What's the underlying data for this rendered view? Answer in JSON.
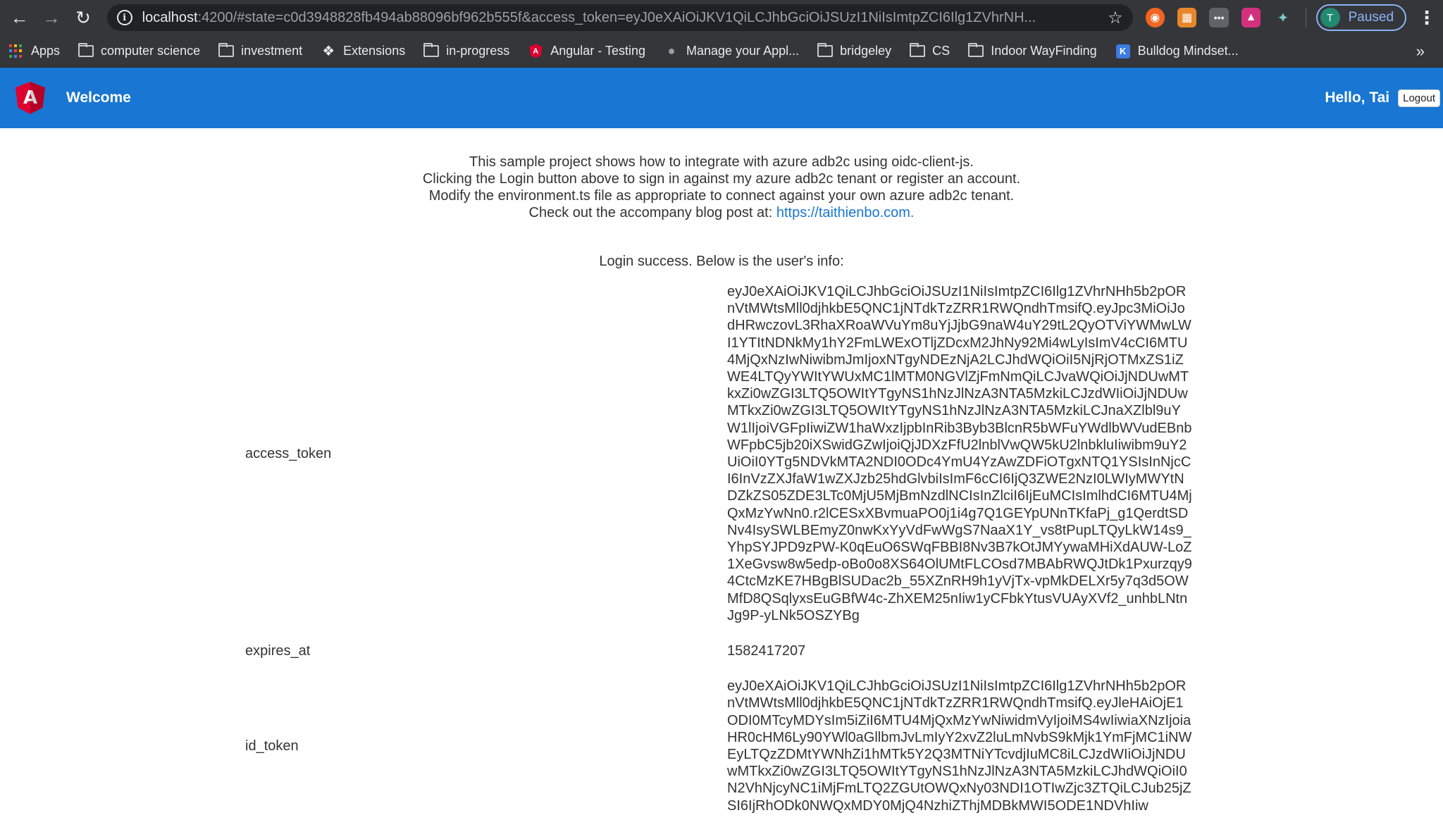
{
  "browser": {
    "url_host": "localhost",
    "url_rest": ":4200/#state=c0d3948828fb494ab88096bf962b555f&access_token=eyJ0eXAiOiJKV1QiLCJhbGciOiJSUzI1NiIsImtpZCI6Ilg1ZVhrNH...",
    "profile_initial": "T",
    "profile_status": "Paused",
    "bookmarks": [
      {
        "label": "Apps",
        "icon": "apps-grid-icon"
      },
      {
        "label": "computer science",
        "icon": "folder-icon"
      },
      {
        "label": "investment",
        "icon": "folder-icon"
      },
      {
        "label": "Extensions",
        "icon": "puzzle-icon"
      },
      {
        "label": "in-progress",
        "icon": "folder-icon"
      },
      {
        "label": "Angular - Testing",
        "icon": "angular-icon"
      },
      {
        "label": "Manage your Appl...",
        "icon": "apple-icon"
      },
      {
        "label": "bridgeley",
        "icon": "folder-icon"
      },
      {
        "label": "CS",
        "icon": "folder-icon"
      },
      {
        "label": "Indoor WayFinding",
        "icon": "folder-icon"
      },
      {
        "label": "Bulldog Mindset...",
        "icon": "bulldog-icon"
      }
    ],
    "bookmarks_overflow": "»"
  },
  "header": {
    "logo_letter": "A",
    "title": "Welcome",
    "greeting": "Hello, Tai",
    "logout_label": "Logout"
  },
  "intro": {
    "line1": "This sample project shows how to integrate with azure adb2c using oidc-client-js.",
    "line2": "Clicking the Login button above to sign in against my azure adb2c tenant or register an account.",
    "line3": "Modify the environment.ts file as appropriate to connect against your own azure adb2c tenant.",
    "line4_prefix": "Check out the accompany blog post at: ",
    "blog_link": "https://taithienbo.com."
  },
  "success_message": "Login success. Below is the user's info:",
  "user_info": [
    {
      "key": "access_token",
      "value": "eyJ0eXAiOiJKV1QiLCJhbGciOiJSUzI1NiIsImtpZCI6Ilg1ZVhrNHh5b2pORnVtMWtsMll0djhkbE5QNC1jNTdkTzZRR1RWQndhTmsifQ.eyJpc3MiOiJodHRwczovL3RhaXRoaWVuYm8uYjJjbG9naW4uY29tL2QyOTViYWMwLWI1YTItNDNkMy1hY2FmLWExOTljZDcxM2JhNy92Mi4wLyIsImV4cCI6MTU4MjQxNzIwNiwibmJmIjoxNTgyNDEzNjA2LCJhdWQiOiI5NjRjOTMxZS1iZWE4LTQyYWItYWUxMC1lMTM0NGVlZjFmNmQiLCJvaWQiOiJjNDUwMTkxZi0wZGI3LTQ5OWItYTgyNS1hNzJlNzA3NTA5MzkiLCJzdWIiOiJjNDUwMTkxZi0wZGI3LTQ5OWItYTgyNS1hNzJlNzA3NTA5MzkiLCJnaXZlbl9uYW1lIjoiVGFpIiwiZW1haWxzIjpbInRib3Byb3BlcnR5bWFuYWdlbWVudEBnbWFpbC5jb20iXSwidGZwIjoiQjJDXzFfU2lnblVwQW5kU2lnbkluIiwibm9uY2UiOiI0YTg5NDVkMTA2NDI0ODc4YmU4YzAwZDFiOTgxNTQ1YSIsInNjcCI6InVzZXJfaW1wZXJzb25hdGlvbiIsImF6cCI6IjQ3ZWE2NzI0LWIyMWYtNDZkZS05ZDE3LTc0MjU5MjBmNzdlNCIsInZlciI6IjEuMCIsImlhdCI6MTU4MjQxMzYwNn0.r2lCESxXBvmuaPO0j1i4g7Q1GEYpUNnTKfaPj_g1QerdtSDNv4IsySWLBEmyZ0nwKxYyVdFwWgS7NaaX1Y_vs8tPupLTQyLkW14s9_YhpSYJPD9zPW-K0qEuO6SWqFBBI8Nv3B7kOtJMYywaMHiXdAUW-LoZ1XeGvsw8w5edp-oBo0o8XS64OlUMtFLCOsd7MBAbRWQJtDk1Pxurzqy94CtcMzKE7HBgBlSUDac2b_55XZnRH9h1yVjTx-vpMkDELXr5y7q3d5OWMfD8QSqlyxsEuGBfW4c-ZhXEM25nIiw1yCFbkYtusVUAyXVf2_unhbLNtnJg9P-yLNk5OSZYBg"
    },
    {
      "key": "expires_at",
      "value": "1582417207"
    },
    {
      "key": "id_token",
      "value": "eyJ0eXAiOiJKV1QiLCJhbGciOiJSUzI1NiIsImtpZCI6Ilg1ZVhrNHh5b2pORnVtMWtsMll0djhkbE5QNC1jNTdkTzZRR1RWQndhTmsifQ.eyJleHAiOjE1ODI0MTcyMDYsIm5iZiI6MTU4MjQxMzYwNiwidmVyIjoiMS4wIiwiaXNzIjoiaHR0cHM6Ly90YWl0aGllbmJvLmIyY2xvZ2luLmNvbS9kMjk1YmFjMC1iNWEyLTQzZDMtYWNhZi1hMTk5Y2Q3MTNiYTcvdjIuMC8iLCJzdWIiOiJjNDUwMTkxZi0wZGI3LTQ5OWItYTgyNS1hNzJlNzA3NTA5MzkiLCJhdWQiOiI0N2VhNjcyNC1iMjFmLTQ2ZGUtOWQxNy03NDI1OTIwZjc3ZTQiLCJub25jZSI6IjRhODk0NWQxMDY0MjQ4NzhiZThjMDBkMWI5ODE1NDVhIiw"
    }
  ]
}
